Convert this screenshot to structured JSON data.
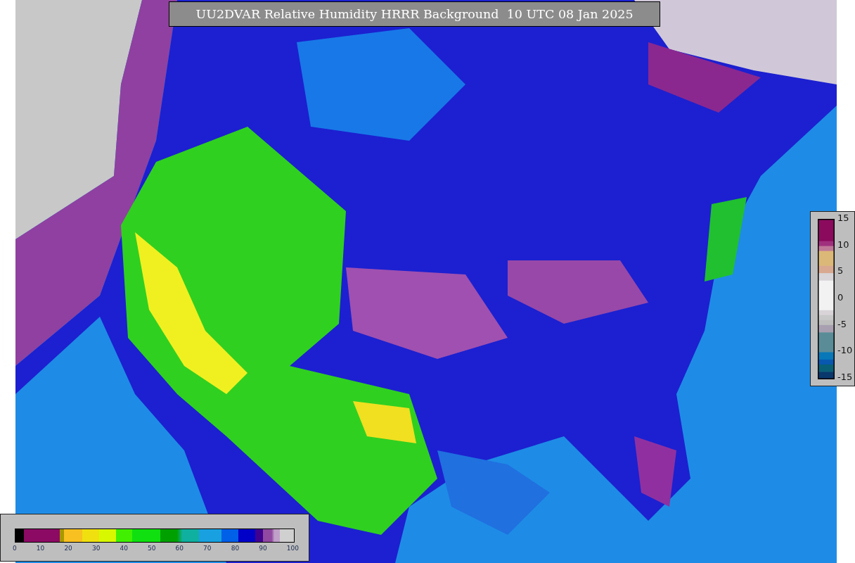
{
  "title": "UU2DVAR Relative Humidity HRRR Background  10 UTC 08 Jan 2025",
  "side_legend": {
    "ticks": [
      "15",
      "10",
      "5",
      "0",
      "-5",
      "-10",
      "-15"
    ]
  },
  "bottom_legend": {
    "ticks": [
      "0",
      "10",
      "20",
      "30",
      "40",
      "50",
      "60",
      "70",
      "80",
      "90",
      "100"
    ]
  }
}
